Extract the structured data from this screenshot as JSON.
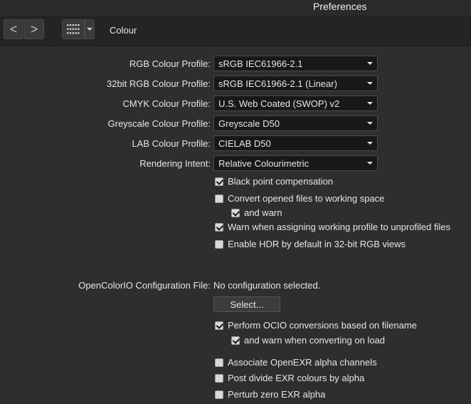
{
  "window": {
    "title": "Preferences"
  },
  "toolbar": {
    "back_glyph": "<",
    "forward_glyph": ">",
    "section": "Colour"
  },
  "profiles": [
    {
      "label": "RGB Colour Profile:",
      "value": "sRGB IEC61966-2.1"
    },
    {
      "label": "32bit RGB Colour Profile:",
      "value": "sRGB IEC61966-2.1 (Linear)"
    },
    {
      "label": "CMYK Colour Profile:",
      "value": "U.S. Web Coated (SWOP) v2"
    },
    {
      "label": "Greyscale Colour Profile:",
      "value": "Greyscale D50"
    },
    {
      "label": "LAB Colour Profile:",
      "value": "CIELAB D50"
    },
    {
      "label": "Rendering Intent:",
      "value": "Relative Colourimetric"
    }
  ],
  "options": [
    {
      "label": "Black point compensation",
      "checked": true
    },
    {
      "label": "Convert opened files to working space",
      "checked": false
    },
    {
      "label": "and warn",
      "checked": true
    },
    {
      "label": "Warn when assigning working profile to unprofiled files",
      "checked": true
    },
    {
      "label": "Enable HDR by default in 32-bit RGB views",
      "checked": false
    }
  ],
  "ocio": {
    "label": "OpenColorIO Configuration File:",
    "value": "No configuration selected.",
    "select_button": "Select...",
    "options": [
      {
        "label": "Perform OCIO conversions based on filename",
        "checked": true
      },
      {
        "label": "and warn when converting on load",
        "checked": true
      },
      {
        "label": "Associate OpenEXR alpha channels",
        "checked": false
      },
      {
        "label": "Post divide EXR colours by alpha",
        "checked": false
      },
      {
        "label": "Perturb zero EXR alpha",
        "checked": false
      }
    ]
  }
}
